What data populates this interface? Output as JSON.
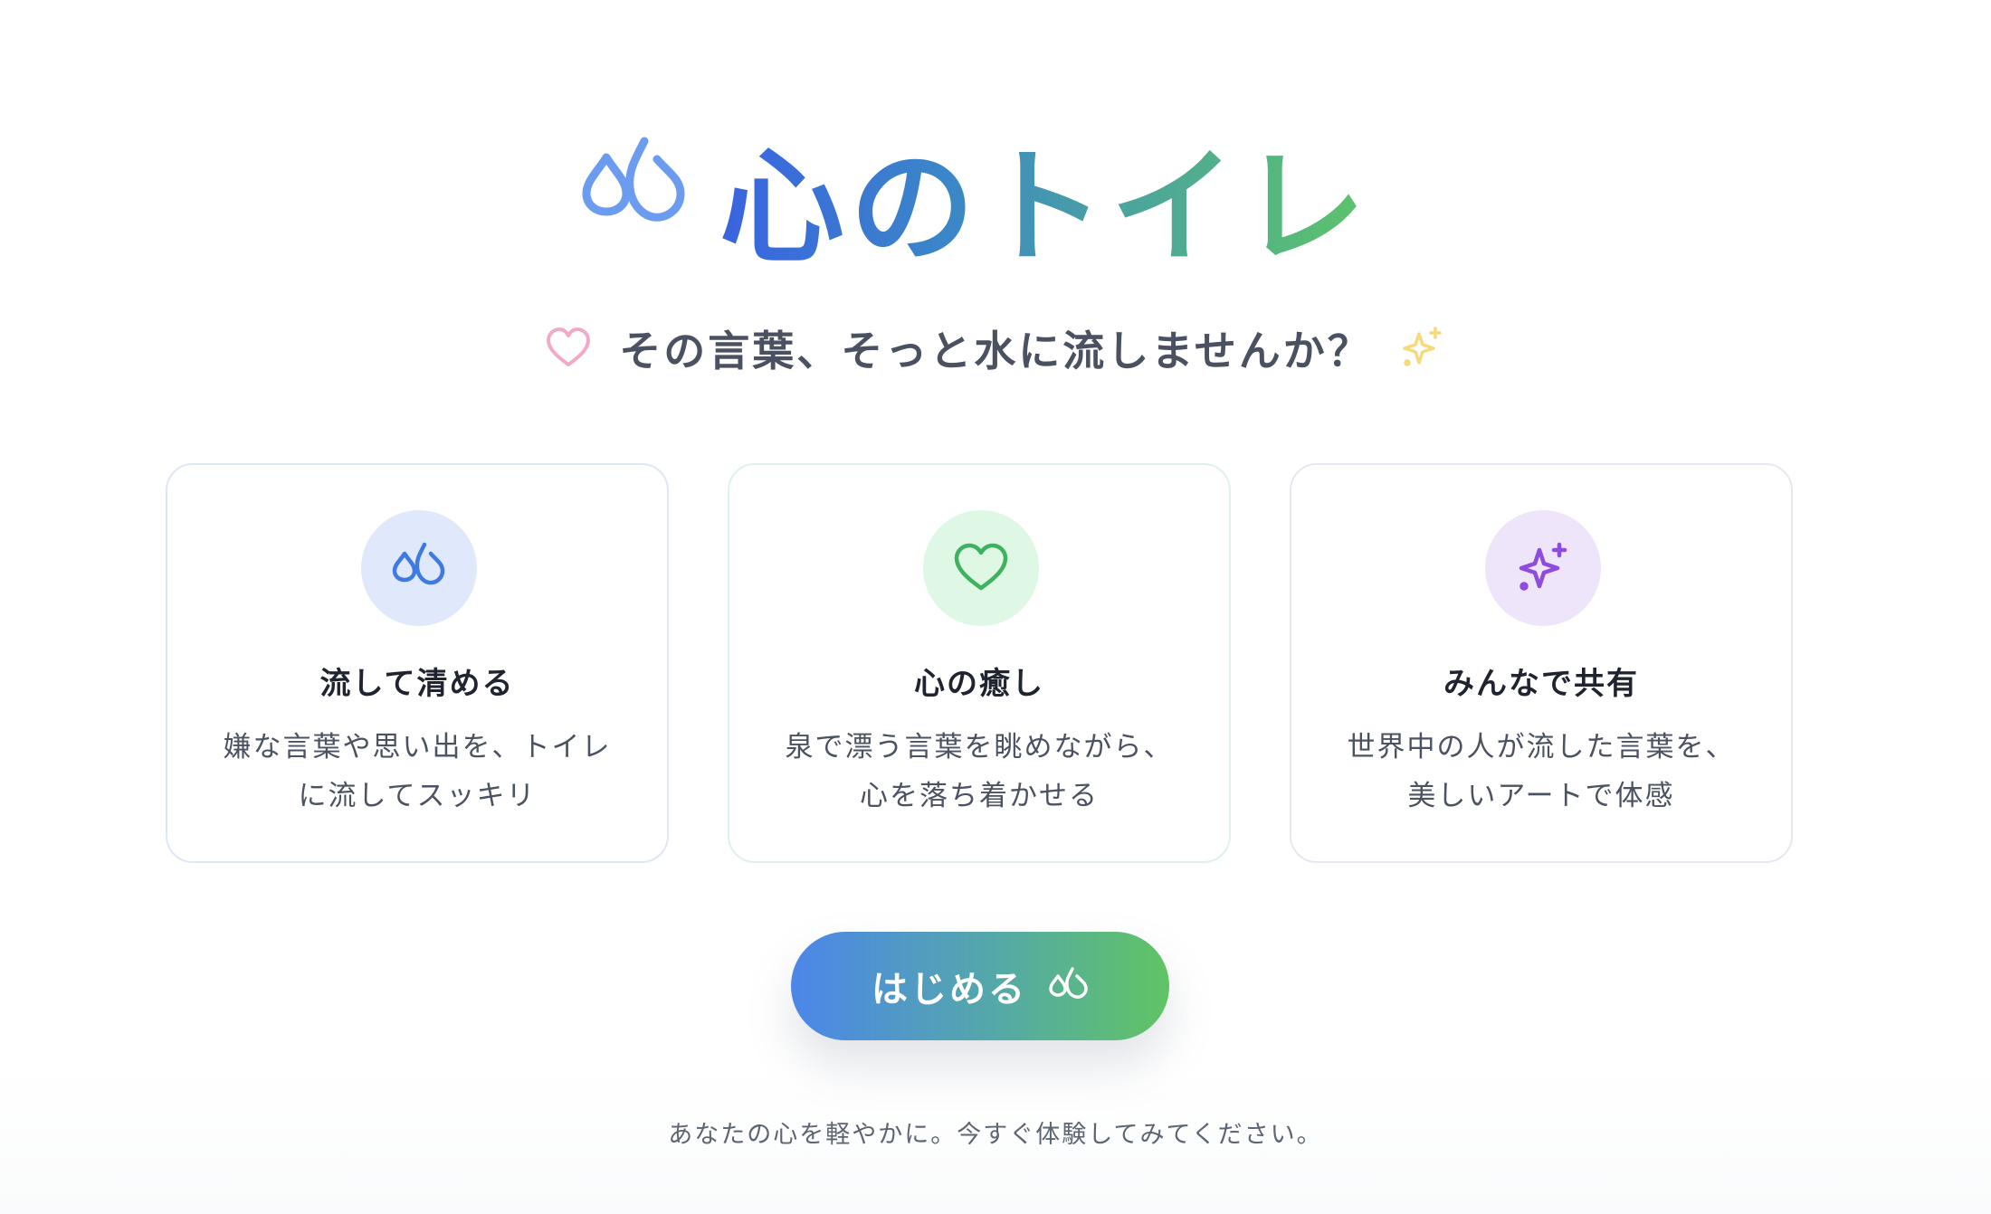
{
  "hero": {
    "title": "心のトイレ",
    "icon": "droplets-icon"
  },
  "subtitle": {
    "text": "その言葉、そっと水に流しませんか？",
    "left_icon": "heart-icon",
    "right_icon": "sparkles-icon"
  },
  "features": [
    {
      "icon": "droplets-icon",
      "title": "流して清める",
      "desc_line1": "嫌な言葉や思い出を、トイレ",
      "desc_line2": "に流してスッキリ",
      "accent": "#3f7ae0"
    },
    {
      "icon": "heart-icon",
      "title": "心の癒し",
      "desc_line1": "泉で漂う言葉を眺めながら、",
      "desc_line2": "心を落ち着かせる",
      "accent": "#3fb25f"
    },
    {
      "icon": "sparkles-icon",
      "title": "みんなで共有",
      "desc_line1": "世界中の人が流した言葉を、",
      "desc_line2": "美しいアートで体感",
      "accent": "#8e4be0"
    }
  ],
  "cta": {
    "label": "はじめる",
    "icon": "droplets-icon"
  },
  "footer": {
    "text": "あなたの心を軽やかに。今すぐ体験してみてください。"
  },
  "colors": {
    "gradient_start": "#3a63e0",
    "gradient_end": "#5cc46a",
    "text_dark": "#1f2430",
    "text_muted": "#5d6472"
  }
}
